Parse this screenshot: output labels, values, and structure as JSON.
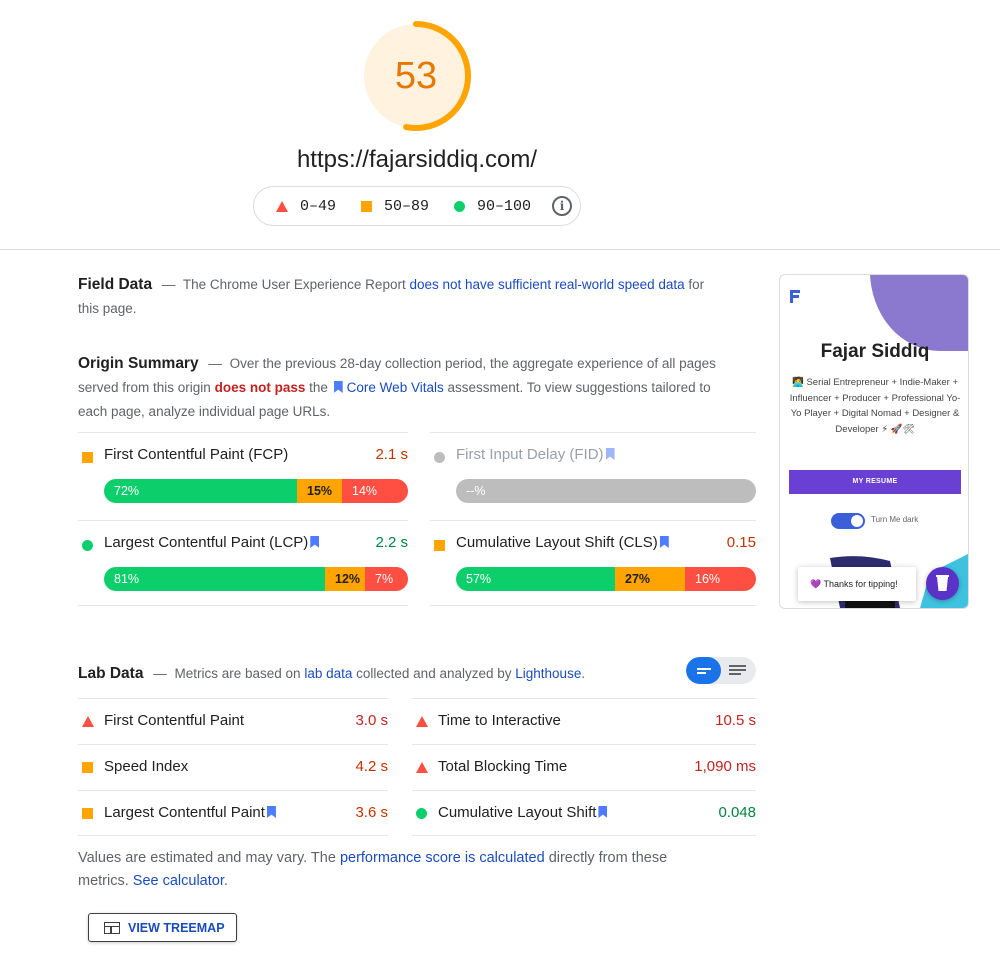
{
  "score": {
    "value": "53",
    "fraction": 0.53,
    "color": "#ffa400"
  },
  "url": "https://fajarsiddiq.com/",
  "legend": {
    "bad": "0–49",
    "average": "50–89",
    "good": "90–100",
    "info_icon": "info-icon"
  },
  "field_data": {
    "title": "Field Data",
    "dash": "—",
    "text_1": "The Chrome User Experience Report",
    "link": "does not have sufficient real-world speed data",
    "text_2": "for this page."
  },
  "origin_summary": {
    "title": "Origin Summary",
    "dash": "—",
    "text_1": "Over the previous 28-day collection period, the aggregate experience of all pages served from this origin",
    "fail": "does not pass",
    "text_2": "the",
    "link": "Core Web Vitals",
    "text_3": "assessment. To view suggestions tailored to each page, analyze individual page URLs."
  },
  "origin_metrics": {
    "fcp": {
      "name": "First Contentful Paint (FCP)",
      "value": "2.1 s",
      "good": "72%",
      "avg": "15%",
      "poor": "14%"
    },
    "fid": {
      "name": "First Input Delay (FID)",
      "value": "--%"
    },
    "lcp": {
      "name": "Largest Contentful Paint (LCP)",
      "value": "2.2 s",
      "good": "81%",
      "avg": "12%",
      "poor": "7%"
    },
    "cls": {
      "name": "Cumulative Layout Shift (CLS)",
      "value": "0.15",
      "good": "57%",
      "avg": "27%",
      "poor": "16%"
    }
  },
  "thumbnail": {
    "name": "Fajar Siddiq",
    "bio": "🧑‍💻 Serial Entrepreneur + Indie-Maker + Influencer + Producer + Professional Yo-Yo Player + Digital Nomad + Designer & Developer ⚡ 🚀🛠",
    "button": "MY RESUME",
    "toggle_label": "Turn Me dark",
    "tip": "💜 Thanks for tipping!"
  },
  "lab_data": {
    "title": "Lab Data",
    "dash": "—",
    "text_1": "Metrics are based on",
    "link_1": "lab data",
    "text_2": "collected and analyzed by",
    "link_2": "Lighthouse",
    "text_3": "."
  },
  "lab_metrics": {
    "fcp": {
      "name": "First Contentful Paint",
      "value": "3.0 s"
    },
    "tti": {
      "name": "Time to Interactive",
      "value": "10.5 s"
    },
    "si": {
      "name": "Speed Index",
      "value": "4.2 s"
    },
    "tbt": {
      "name": "Total Blocking Time",
      "value": "1,090 ms"
    },
    "lcp": {
      "name": "Largest Contentful Paint",
      "value": "3.6 s"
    },
    "cls": {
      "name": "Cumulative Layout Shift",
      "value": "0.048"
    }
  },
  "footnote": {
    "text_1": "Values are estimated and may vary. The",
    "link_1": "performance score is calculated",
    "text_2": "directly from these metrics.",
    "link_2": "See calculator",
    "text_3": "."
  },
  "treemap_button": "VIEW TREEMAP",
  "colors": {
    "good": "#0cce6b",
    "average": "#ffa400",
    "poor": "#ff4e42",
    "link": "#1a4bbf"
  }
}
